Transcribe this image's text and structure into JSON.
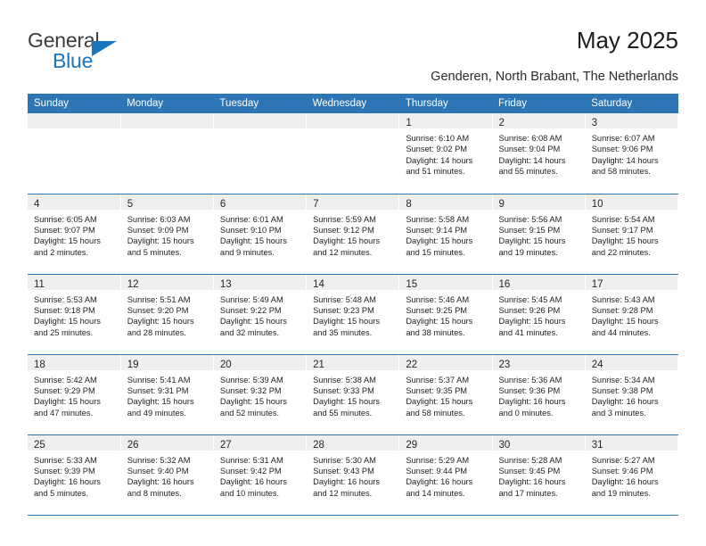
{
  "brand": {
    "name_part1": "General",
    "name_part2": "Blue",
    "accent_color": "#1b75bb",
    "triangle_icon": "brand-triangle-icon"
  },
  "header": {
    "title": "May 2025",
    "subtitle": "Genderen, North Brabant, The Netherlands"
  },
  "calendar": {
    "header_bg": "#2e75b6",
    "daynum_bg": "#efefef",
    "weekday_headers": [
      "Sunday",
      "Monday",
      "Tuesday",
      "Wednesday",
      "Thursday",
      "Friday",
      "Saturday"
    ],
    "weeks": [
      [
        {
          "day": "",
          "lines": []
        },
        {
          "day": "",
          "lines": []
        },
        {
          "day": "",
          "lines": []
        },
        {
          "day": "",
          "lines": []
        },
        {
          "day": "1",
          "lines": [
            "Sunrise: 6:10 AM",
            "Sunset: 9:02 PM",
            "Daylight: 14 hours",
            "and 51 minutes."
          ]
        },
        {
          "day": "2",
          "lines": [
            "Sunrise: 6:08 AM",
            "Sunset: 9:04 PM",
            "Daylight: 14 hours",
            "and 55 minutes."
          ]
        },
        {
          "day": "3",
          "lines": [
            "Sunrise: 6:07 AM",
            "Sunset: 9:06 PM",
            "Daylight: 14 hours",
            "and 58 minutes."
          ]
        }
      ],
      [
        {
          "day": "4",
          "lines": [
            "Sunrise: 6:05 AM",
            "Sunset: 9:07 PM",
            "Daylight: 15 hours",
            "and 2 minutes."
          ]
        },
        {
          "day": "5",
          "lines": [
            "Sunrise: 6:03 AM",
            "Sunset: 9:09 PM",
            "Daylight: 15 hours",
            "and 5 minutes."
          ]
        },
        {
          "day": "6",
          "lines": [
            "Sunrise: 6:01 AM",
            "Sunset: 9:10 PM",
            "Daylight: 15 hours",
            "and 9 minutes."
          ]
        },
        {
          "day": "7",
          "lines": [
            "Sunrise: 5:59 AM",
            "Sunset: 9:12 PM",
            "Daylight: 15 hours",
            "and 12 minutes."
          ]
        },
        {
          "day": "8",
          "lines": [
            "Sunrise: 5:58 AM",
            "Sunset: 9:14 PM",
            "Daylight: 15 hours",
            "and 15 minutes."
          ]
        },
        {
          "day": "9",
          "lines": [
            "Sunrise: 5:56 AM",
            "Sunset: 9:15 PM",
            "Daylight: 15 hours",
            "and 19 minutes."
          ]
        },
        {
          "day": "10",
          "lines": [
            "Sunrise: 5:54 AM",
            "Sunset: 9:17 PM",
            "Daylight: 15 hours",
            "and 22 minutes."
          ]
        }
      ],
      [
        {
          "day": "11",
          "lines": [
            "Sunrise: 5:53 AM",
            "Sunset: 9:18 PM",
            "Daylight: 15 hours",
            "and 25 minutes."
          ]
        },
        {
          "day": "12",
          "lines": [
            "Sunrise: 5:51 AM",
            "Sunset: 9:20 PM",
            "Daylight: 15 hours",
            "and 28 minutes."
          ]
        },
        {
          "day": "13",
          "lines": [
            "Sunrise: 5:49 AM",
            "Sunset: 9:22 PM",
            "Daylight: 15 hours",
            "and 32 minutes."
          ]
        },
        {
          "day": "14",
          "lines": [
            "Sunrise: 5:48 AM",
            "Sunset: 9:23 PM",
            "Daylight: 15 hours",
            "and 35 minutes."
          ]
        },
        {
          "day": "15",
          "lines": [
            "Sunrise: 5:46 AM",
            "Sunset: 9:25 PM",
            "Daylight: 15 hours",
            "and 38 minutes."
          ]
        },
        {
          "day": "16",
          "lines": [
            "Sunrise: 5:45 AM",
            "Sunset: 9:26 PM",
            "Daylight: 15 hours",
            "and 41 minutes."
          ]
        },
        {
          "day": "17",
          "lines": [
            "Sunrise: 5:43 AM",
            "Sunset: 9:28 PM",
            "Daylight: 15 hours",
            "and 44 minutes."
          ]
        }
      ],
      [
        {
          "day": "18",
          "lines": [
            "Sunrise: 5:42 AM",
            "Sunset: 9:29 PM",
            "Daylight: 15 hours",
            "and 47 minutes."
          ]
        },
        {
          "day": "19",
          "lines": [
            "Sunrise: 5:41 AM",
            "Sunset: 9:31 PM",
            "Daylight: 15 hours",
            "and 49 minutes."
          ]
        },
        {
          "day": "20",
          "lines": [
            "Sunrise: 5:39 AM",
            "Sunset: 9:32 PM",
            "Daylight: 15 hours",
            "and 52 minutes."
          ]
        },
        {
          "day": "21",
          "lines": [
            "Sunrise: 5:38 AM",
            "Sunset: 9:33 PM",
            "Daylight: 15 hours",
            "and 55 minutes."
          ]
        },
        {
          "day": "22",
          "lines": [
            "Sunrise: 5:37 AM",
            "Sunset: 9:35 PM",
            "Daylight: 15 hours",
            "and 58 minutes."
          ]
        },
        {
          "day": "23",
          "lines": [
            "Sunrise: 5:36 AM",
            "Sunset: 9:36 PM",
            "Daylight: 16 hours",
            "and 0 minutes."
          ]
        },
        {
          "day": "24",
          "lines": [
            "Sunrise: 5:34 AM",
            "Sunset: 9:38 PM",
            "Daylight: 16 hours",
            "and 3 minutes."
          ]
        }
      ],
      [
        {
          "day": "25",
          "lines": [
            "Sunrise: 5:33 AM",
            "Sunset: 9:39 PM",
            "Daylight: 16 hours",
            "and 5 minutes."
          ]
        },
        {
          "day": "26",
          "lines": [
            "Sunrise: 5:32 AM",
            "Sunset: 9:40 PM",
            "Daylight: 16 hours",
            "and 8 minutes."
          ]
        },
        {
          "day": "27",
          "lines": [
            "Sunrise: 5:31 AM",
            "Sunset: 9:42 PM",
            "Daylight: 16 hours",
            "and 10 minutes."
          ]
        },
        {
          "day": "28",
          "lines": [
            "Sunrise: 5:30 AM",
            "Sunset: 9:43 PM",
            "Daylight: 16 hours",
            "and 12 minutes."
          ]
        },
        {
          "day": "29",
          "lines": [
            "Sunrise: 5:29 AM",
            "Sunset: 9:44 PM",
            "Daylight: 16 hours",
            "and 14 minutes."
          ]
        },
        {
          "day": "30",
          "lines": [
            "Sunrise: 5:28 AM",
            "Sunset: 9:45 PM",
            "Daylight: 16 hours",
            "and 17 minutes."
          ]
        },
        {
          "day": "31",
          "lines": [
            "Sunrise: 5:27 AM",
            "Sunset: 9:46 PM",
            "Daylight: 16 hours",
            "and 19 minutes."
          ]
        }
      ]
    ]
  }
}
